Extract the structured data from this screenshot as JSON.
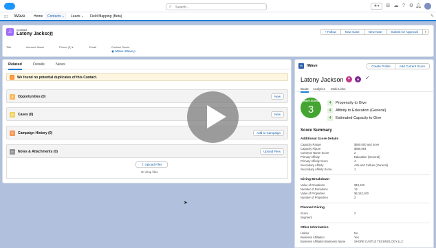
{
  "global": {
    "search_placeholder": "Search..."
  },
  "nav": {
    "app_name": "iWave",
    "items": [
      {
        "label": "Home"
      },
      {
        "label": "Contacts"
      },
      {
        "label": "Leads"
      },
      {
        "label": "Field Mapping (Beta)"
      }
    ]
  },
  "record": {
    "object_label": "Contact",
    "name": "Latony Jackson",
    "actions": [
      "Follow",
      "New Case",
      "New Note",
      "Submit for Approval"
    ],
    "fields": [
      {
        "label": "Title",
        "value": ""
      },
      {
        "label": "Account Name",
        "value": ""
      },
      {
        "label": "Phone (2)",
        "value": ""
      },
      {
        "label": "Email",
        "value": ""
      },
      {
        "label": "Contact Owner",
        "value": "iWave iWave p"
      }
    ]
  },
  "left_panel": {
    "tabs": [
      "Related",
      "Details",
      "News"
    ],
    "duplicates_message": "We found no potential duplicates of this Contact.",
    "cards": [
      {
        "title": "Opportunities (0)",
        "button": "New",
        "icon_color": "#fcb95b"
      },
      {
        "title": "Cases (0)",
        "button": "New",
        "icon_color": "#f2cf5b"
      },
      {
        "title": "Campaign History (0)",
        "button": "Add to Campaign",
        "icon_color": "#f49756"
      },
      {
        "title": "Notes & Attachments (0)",
        "button": "Upload Files",
        "icon_color": "#939393"
      }
    ],
    "upload_button": "Upload Files",
    "drop_text": "Or drop files"
  },
  "right_panel": {
    "brand": "iWave",
    "buttons": [
      "Create Profile",
      "Add Current Score"
    ],
    "name": "Latony Jackson",
    "tabs": [
      "Score",
      "Analytics",
      "Multi-Links"
    ],
    "score": {
      "label": "iWAVE SCORE",
      "value": "3"
    },
    "score_items": [
      {
        "num": "4",
        "label": "Propensity to Give"
      },
      {
        "num": "4",
        "label": "Affinity to Education (General)"
      },
      {
        "num": "4",
        "label": "Estimated Capacity to Give"
      }
    ],
    "summary_title": "Score Summary",
    "sections": [
      {
        "title": "Additional Score Details",
        "rows": [
          {
            "k": "Capacity Range",
            "v": "$500,000 and more"
          },
          {
            "k": "Capacity Figure",
            "v": "$686,094"
          },
          {
            "k": "Common Name Score",
            "v": "2"
          },
          {
            "k": "Primary Affinity",
            "v": "Education (General)"
          },
          {
            "k": "Primary Affinity Score",
            "v": "4"
          },
          {
            "k": "Secondary Affinity",
            "v": "Arts and Culture (General)"
          },
          {
            "k": "Secondary Affinity Score",
            "v": "1"
          }
        ]
      },
      {
        "title": "Giving Breakdown",
        "rows": [
          {
            "k": "Value of Donations",
            "v": "$18,102"
          },
          {
            "k": "Number of Donations",
            "v": "14"
          },
          {
            "k": "Value of Properties",
            "v": "$4,152,100"
          },
          {
            "k": "Number of Properties",
            "v": "2"
          }
        ]
      },
      {
        "title": "Planned Giving",
        "rows": [
          {
            "k": "Score",
            "v": "2"
          },
          {
            "k": "Segment",
            "v": ""
          }
        ]
      },
      {
        "title": "Other Information",
        "rows": [
          {
            "k": "Holder",
            "v": "No"
          },
          {
            "k": "Business Affiliation",
            "v": "Yes"
          },
          {
            "k": "Business Affiliation Business Name",
            "v": "SHORE CASTLE TECHNOLOGY LLC"
          }
        ]
      }
    ]
  },
  "colors": {
    "accent": "#1b7bd8",
    "background": "#b0c0dd",
    "score_green": "#44a532"
  }
}
